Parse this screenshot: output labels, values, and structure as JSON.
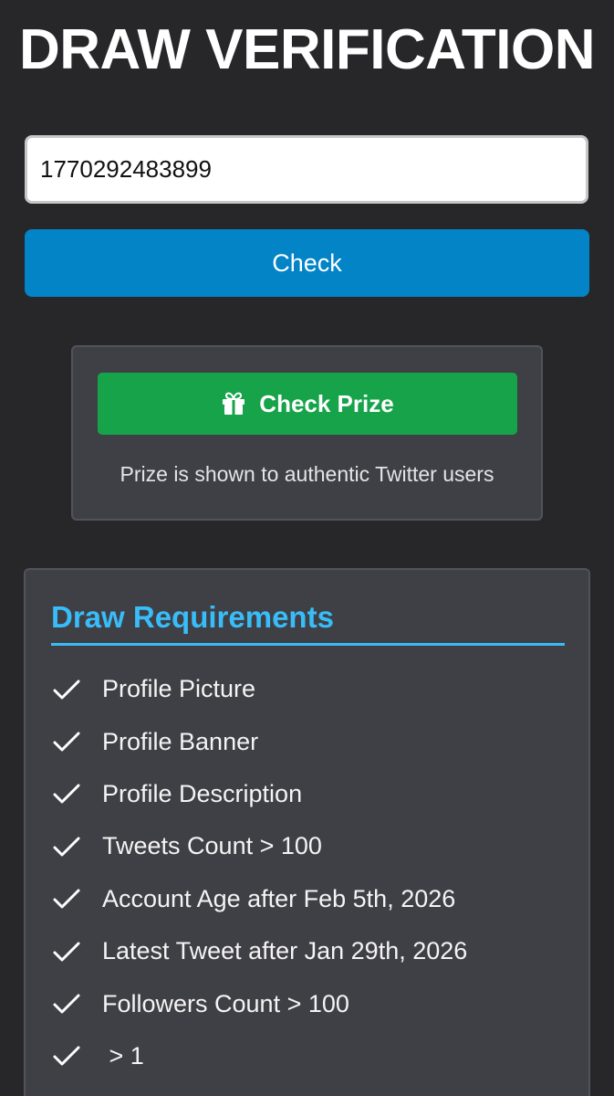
{
  "page": {
    "title": "DRAW VERIFICATION"
  },
  "form": {
    "id_value": "1770292483899",
    "check_label": "Check"
  },
  "prize": {
    "button_label": "Check Prize",
    "button_icon": "gift-icon",
    "note": "Prize is shown to authentic Twitter users"
  },
  "requirements": {
    "title": "Draw Requirements",
    "item_icon": "check-icon",
    "items": [
      "Profile Picture",
      "Profile Banner",
      "Profile Description",
      "Tweets Count > 100",
      "Account Age after Feb 5th, 2026",
      "Latest Tweet after Jan 29th, 2026",
      "Followers Count > 100",
      " > 1"
    ]
  },
  "colors": {
    "background": "#27272a",
    "primary_button": "#0284c7",
    "prize_button": "#16a34a",
    "card": "#3f3f46",
    "accent": "#38bdf8"
  }
}
